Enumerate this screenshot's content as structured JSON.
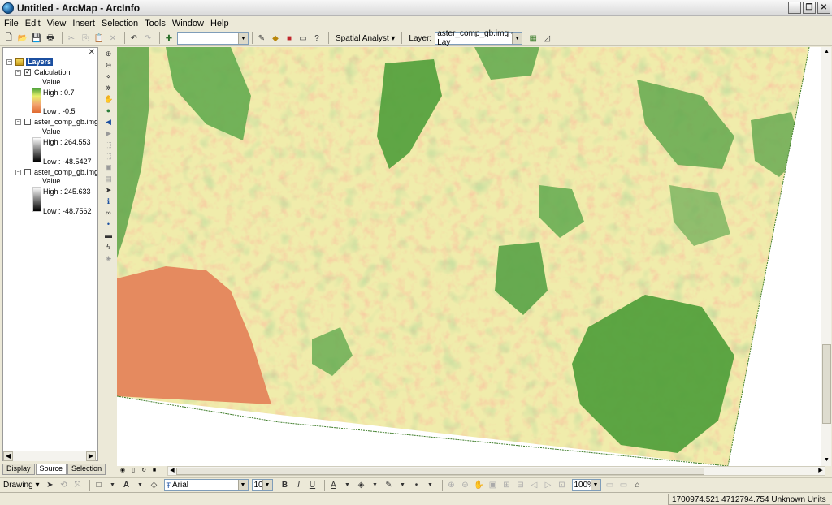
{
  "window": {
    "title": "Untitled - ArcMap - ArcInfo",
    "controls": [
      "minimize",
      "maximize",
      "close"
    ]
  },
  "menu": [
    "File",
    "Edit",
    "View",
    "Insert",
    "Selection",
    "Tools",
    "Window",
    "Help"
  ],
  "toolbar": {
    "scale_value": "",
    "spatial_analyst_label": "Spatial Analyst",
    "layer_label": "Layer:",
    "layer_value": "aster_comp_gb.img - Lay"
  },
  "toc": {
    "root_label": "Layers",
    "layers": [
      {
        "name": "Calculation",
        "checked": true,
        "field": "Value",
        "high": "High : 0.7",
        "low": "Low : -0.5",
        "ramp": [
          "#3f9b37",
          "#e8f06a",
          "#f2a470",
          "#e06a30"
        ]
      },
      {
        "name": "aster_comp_gb.img",
        "checked": false,
        "field": "Value",
        "high": "High : 264.553",
        "low": "Low : -48.5427",
        "ramp": [
          "#ffffff",
          "#000000"
        ]
      },
      {
        "name": "aster_comp_gb.img",
        "checked": false,
        "field": "Value",
        "high": "High : 245.633",
        "low": "Low : -48.7562",
        "ramp": [
          "#ffffff",
          "#000000"
        ]
      }
    ],
    "tabs": [
      "Display",
      "Source",
      "Selection"
    ],
    "active_tab": "Source"
  },
  "drawing": {
    "drawing_label": "Drawing",
    "font": "Arial",
    "size": "10",
    "zoom": "100%"
  },
  "status": {
    "coords": "1700974.521  4712794.754 Unknown Units"
  },
  "colors": {
    "map_green": "#4f9e3a",
    "map_yellow": "#eef0a2",
    "map_orange": "#e8966b"
  }
}
